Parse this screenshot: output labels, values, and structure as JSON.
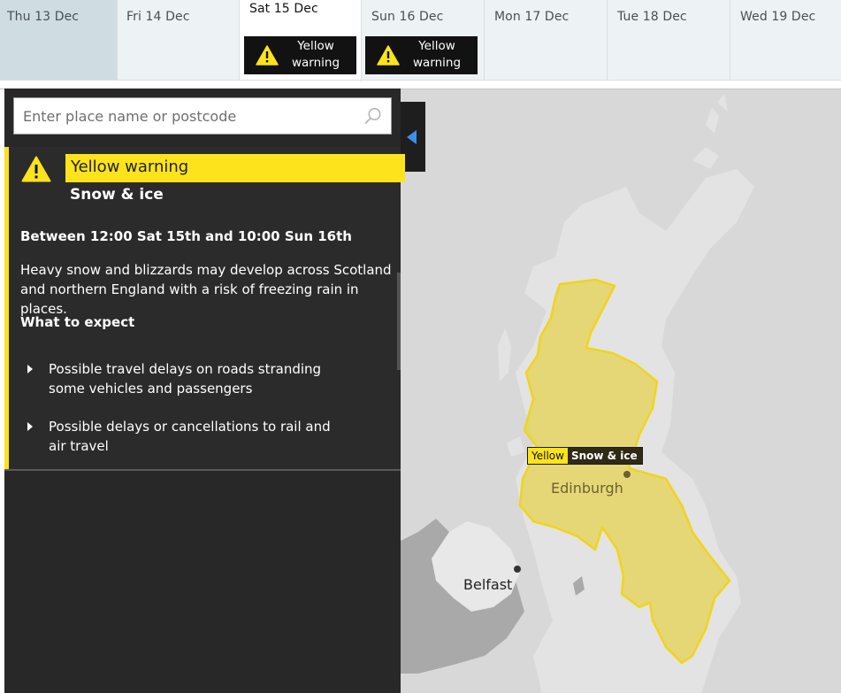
{
  "days": [
    {
      "label": "Thu 13 Dec",
      "state": "past",
      "warning": null
    },
    {
      "label": "Fri 14 Dec",
      "state": "normal",
      "warning": null
    },
    {
      "label": "Sat 15 Dec",
      "state": "selected",
      "warning": "Yellow warning"
    },
    {
      "label": "Sun 16 Dec",
      "state": "normal",
      "warning": "Yellow warning"
    },
    {
      "label": "Mon 17 Dec",
      "state": "normal",
      "warning": null
    },
    {
      "label": "Tue 18 Dec",
      "state": "normal",
      "warning": null
    },
    {
      "label": "Wed 19 Dec",
      "state": "normal",
      "warning": null
    }
  ],
  "search": {
    "placeholder": "Enter place name or postcode",
    "value": ""
  },
  "warning": {
    "level": "Yellow warning",
    "type": "Snow & ice",
    "period": "Between 12:00 Sat 15th and 10:00 Sun 16th",
    "description": "Heavy snow and blizzards may develop across Scotland and northern England with a risk of freezing rain in places.",
    "expect_heading": "What to expect",
    "expect_items": [
      "Possible travel delays on roads stranding some vehicles and passengers",
      "Possible delays or cancellations to rail and air travel"
    ]
  },
  "map": {
    "tag_level": "Yellow",
    "tag_type": "Snow & ice",
    "cities": [
      {
        "name": "Edinburgh",
        "key": "edinburgh"
      },
      {
        "name": "Belfast",
        "key": "belfast"
      }
    ]
  },
  "colors": {
    "warning_yellow": "#fde31b",
    "panel_bg": "#282828",
    "map_land": "#e3e3e3",
    "map_sea": "#d8d8d8",
    "collapse_arrow": "#3d8fe8"
  },
  "icons": {
    "warning": "warning-triangle-icon",
    "search": "search-icon",
    "collapse": "collapse-panel-icon",
    "bullet": "bullet-arrow-icon"
  }
}
